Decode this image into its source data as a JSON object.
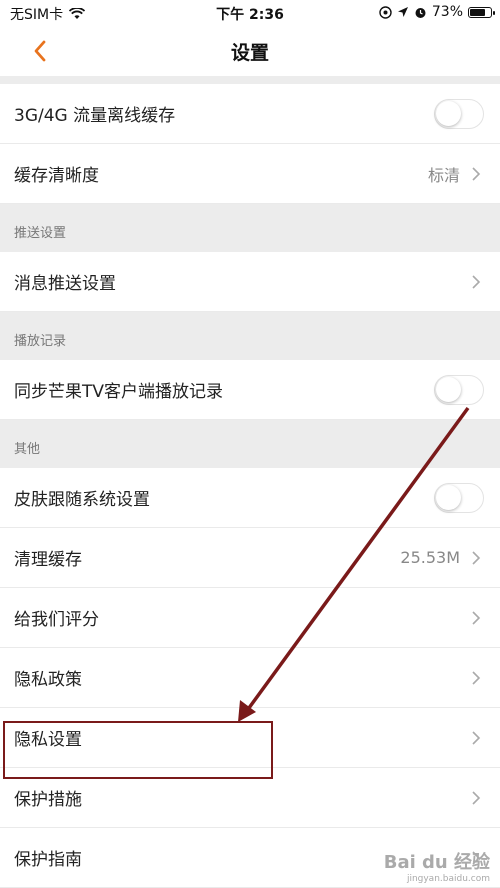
{
  "status": {
    "carrier": "无SIM卡",
    "time": "下午 2:36",
    "battery": "73%",
    "battery_level": 0.73
  },
  "nav": {
    "title": "设置"
  },
  "rows_top": [
    {
      "label": "3G/4G 流量离线缓存",
      "type": "toggle",
      "on": false
    },
    {
      "label": "缓存清晰度",
      "type": "value",
      "value": "标清"
    }
  ],
  "sections": {
    "push": {
      "header": "推送设置",
      "item": "消息推送设置"
    },
    "history": {
      "header": "播放记录",
      "item": "同步芒果TV客户端播放记录"
    },
    "other": {
      "header": "其他",
      "skin": "皮肤跟随系统设置",
      "clear_cache": "清理缓存",
      "cache_size": "25.53M",
      "rate": "给我们评分",
      "privacy_policy": "隐私政策",
      "privacy_settings": "隐私设置",
      "protection": "保护措施",
      "guide": "保护指南"
    }
  },
  "watermark": {
    "brand": "Bai du 经验",
    "url": "jingyan.baidu.com"
  },
  "colors": {
    "accent": "#e8731e",
    "annotation": "#7a1a1a"
  }
}
